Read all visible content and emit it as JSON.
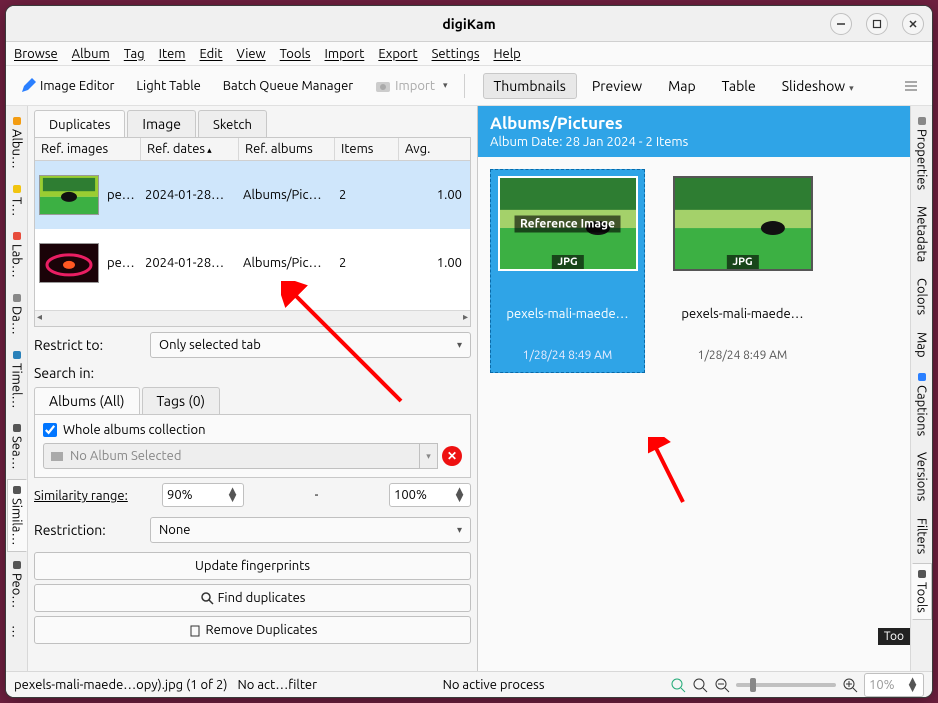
{
  "window": {
    "title": "digiKam"
  },
  "menubar": [
    "Browse",
    "Album",
    "Tag",
    "Item",
    "Edit",
    "View",
    "Tools",
    "Import",
    "Export",
    "Settings",
    "Help"
  ],
  "toolbar": {
    "image_editor": "Image Editor",
    "light_table": "Light Table",
    "batch_queue": "Batch Queue Manager",
    "import": "Import"
  },
  "viewbar": {
    "thumbnails": "Thumbnails",
    "preview": "Preview",
    "map": "Map",
    "table": "Table",
    "slideshow": "Slideshow"
  },
  "left_rail": [
    "Albu…",
    "T…",
    "Lab…",
    "Da…",
    "Timel…",
    "Sea…",
    "Simila…",
    "Peo…",
    "…"
  ],
  "right_rail": [
    "Properties",
    "Metadata",
    "Colors",
    "Map",
    "Captions",
    "Versions",
    "Filters",
    "Tools"
  ],
  "left_panel": {
    "tabs": {
      "duplicates": "Duplicates",
      "image": "Image",
      "sketch": "Sketch"
    },
    "headers": {
      "ref_images": "Ref. images",
      "ref_dates": "Ref. dates",
      "ref_albums": "Ref. albums",
      "items": "Items",
      "avg": "Avg."
    },
    "rows": [
      {
        "name": "pe…",
        "date": "2024-01-28…",
        "album": "Albums/Pic…",
        "items": "2",
        "avg": "1.00"
      },
      {
        "name": "pe…",
        "date": "2024-01-28…",
        "album": "Albums/Pic…",
        "items": "2",
        "avg": "1.00"
      }
    ],
    "restrict_label": "Restrict to:",
    "restrict_value": "Only selected tab",
    "search_label": "Search in:",
    "search_tabs": {
      "albums": "Albums (All)",
      "tags": "Tags (0)"
    },
    "whole_albums": "Whole albums collection",
    "no_album": "No Album Selected",
    "sim_range_label": "Similarity range:",
    "sim_min": "90%",
    "sim_dash": "-",
    "sim_max": "100%",
    "restriction_label": "Restriction:",
    "restriction_value": "None",
    "btn_update": "Update fingerprints",
    "btn_find": "Find duplicates",
    "btn_remove": "Remove Duplicates"
  },
  "album": {
    "title": "Albums/Pictures",
    "subtitle": "Album Date: 28 Jan 2024 - 2 Items",
    "thumbs": [
      {
        "name": "pexels-mali-maede…",
        "date": "1/28/24 8:49 AM",
        "ref_label": "Reference Image",
        "fmt": "JPG"
      },
      {
        "name": "pexels-mali-maede…",
        "date": "1/28/24 8:49 AM",
        "fmt": "JPG"
      }
    ]
  },
  "status": {
    "left": "pexels-mali-maede…opy).jpg (1 of 2)",
    "filter": "No act…filter",
    "process": "No active process",
    "zoom": "10%"
  },
  "tooltip": "Too"
}
